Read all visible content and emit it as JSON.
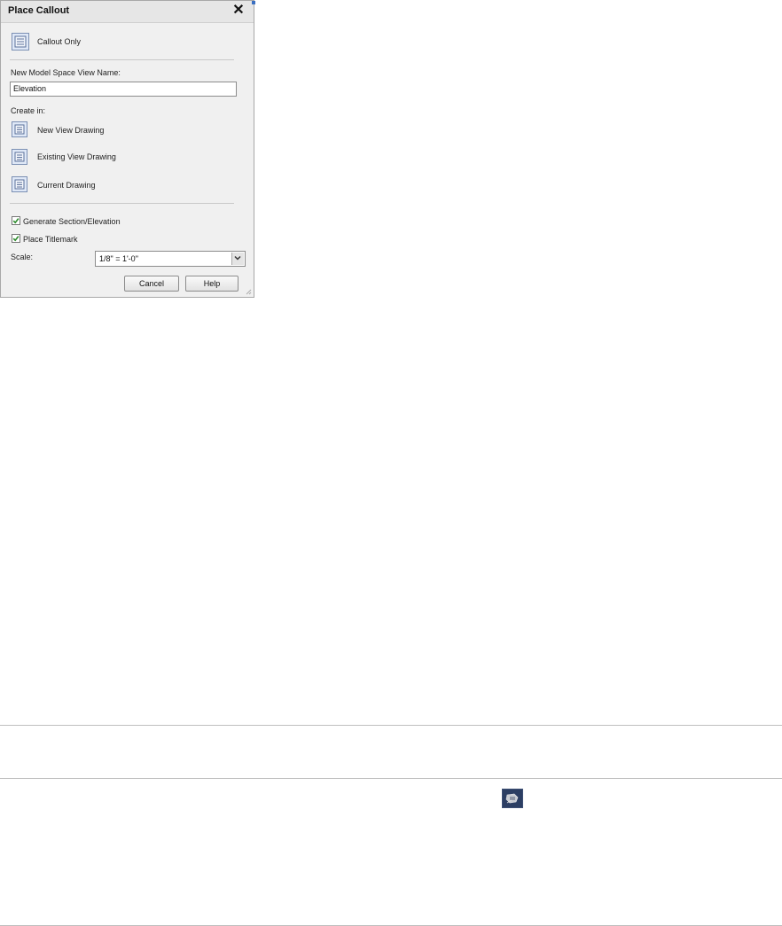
{
  "dialog": {
    "title": "Place Callout",
    "callout_only": "Callout Only",
    "view_name_label": "New Model Space View Name:",
    "view_name_value": "Elevation",
    "create_in_label": "Create in:",
    "create_in_options": [
      "New View Drawing",
      "Existing View Drawing",
      "Current Drawing"
    ],
    "generate_section_label": "Generate Section/Elevation",
    "generate_section_checked": true,
    "place_titlemark_label": "Place Titlemark",
    "place_titlemark_checked": true,
    "scale_label": "Scale:",
    "scale_value": "1/8\" = 1'-0\"",
    "cancel_label": "Cancel",
    "help_label": "Help"
  },
  "icons": {
    "close": "close-icon",
    "callout": "callout-icon",
    "view_drawing": "view-drawing-icon",
    "dropdown": "chevron-down-icon",
    "checkbox": "checkmark-icon",
    "tool": "callout-tool-icon"
  },
  "colors": {
    "dialog_bg": "#f0f0f0",
    "icon_border": "#7b8fb3",
    "checkmark": "#2a8a2a",
    "tool_icon_bg": "#2c3e63"
  }
}
